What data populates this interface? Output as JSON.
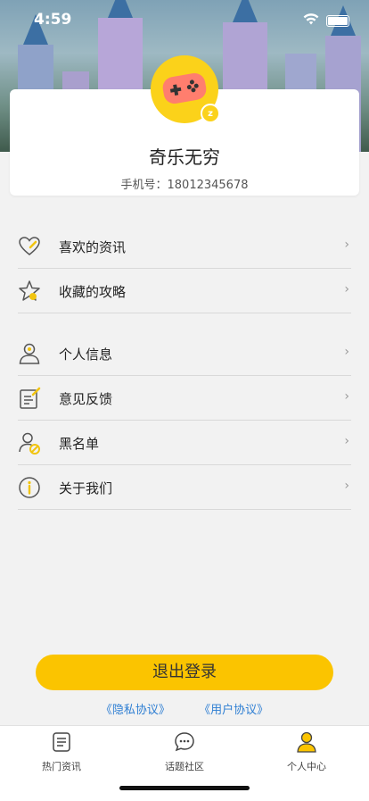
{
  "status": {
    "time": "4:59"
  },
  "profile": {
    "nickname": "奇乐无穷",
    "phone": "手机号：18012345678",
    "badge": "z"
  },
  "menu": {
    "group1": [
      {
        "label": "喜欢的资讯",
        "icon": "heart-icon"
      },
      {
        "label": "收藏的攻略",
        "icon": "star-icon"
      }
    ],
    "group2": [
      {
        "label": "个人信息",
        "icon": "user-icon"
      },
      {
        "label": "意见反馈",
        "icon": "feedback-icon"
      },
      {
        "label": "黑名单",
        "icon": "blacklist-icon"
      },
      {
        "label": "关于我们",
        "icon": "info-icon"
      }
    ],
    "chevron": "›"
  },
  "actions": {
    "logout": "退出登录",
    "privacy": "《隐私协议》",
    "terms": "《用户协议》"
  },
  "tabbar": [
    {
      "label": "热门资讯",
      "icon": "news-icon"
    },
    {
      "label": "话题社区",
      "icon": "chat-icon"
    },
    {
      "label": "个人中心",
      "icon": "profile-icon",
      "active": true
    }
  ],
  "colors": {
    "accent": "#fbc400",
    "link": "#2f7fd3"
  }
}
